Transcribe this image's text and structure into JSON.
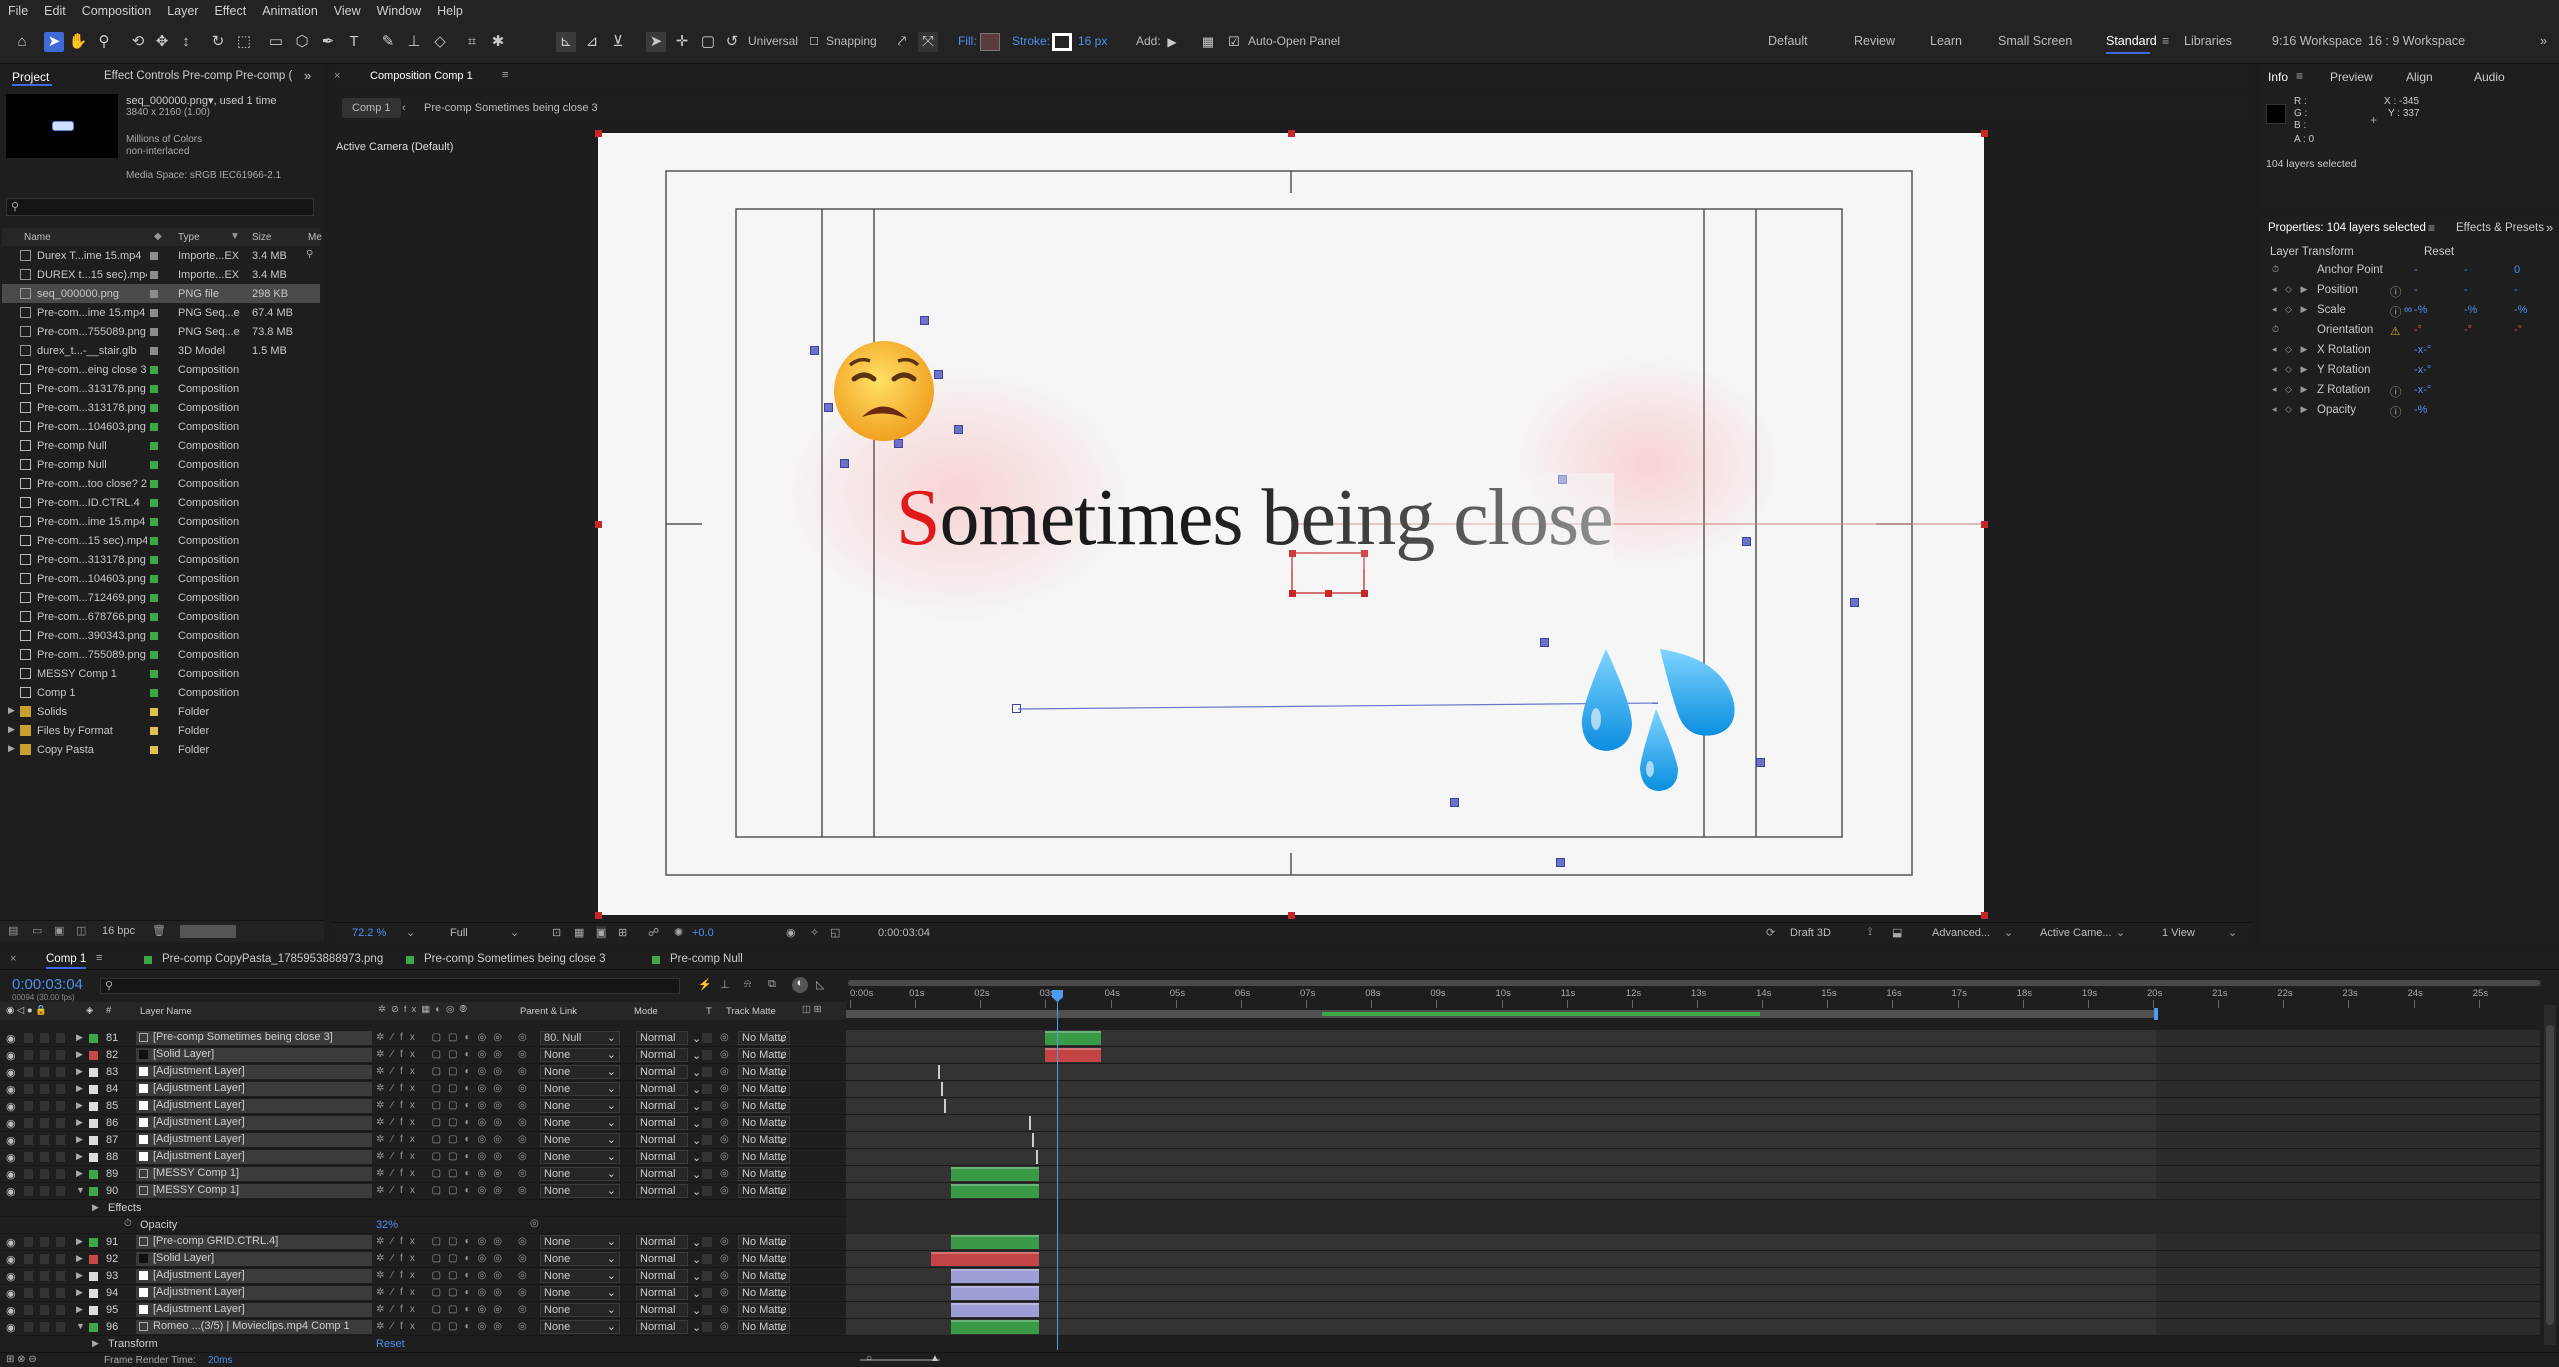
{
  "menu": [
    "File",
    "Edit",
    "Composition",
    "Layer",
    "Effect",
    "Animation",
    "View",
    "Window",
    "Help"
  ],
  "toolbar": {
    "universal": "Universal",
    "snapping": "Snapping",
    "fill": "Fill:",
    "stroke": "Stroke:",
    "stroke_px": "16 px",
    "add": "Add:",
    "auto_open": "Auto-Open Panel"
  },
  "workspaces": [
    "Default",
    "Review",
    "Learn",
    "Small Screen",
    "Standard",
    "Libraries",
    "9:16 Workspace",
    "16 : 9 Workspace"
  ],
  "project": {
    "tab_project": "Project",
    "tab_effects": "Effect Controls Pre-comp Pre-comp (",
    "item_name": "seq_000000.png",
    "item_used": ", used 1 time",
    "item_res": "3840 x 2160 (1.00)",
    "item_colors": "Millions of Colors",
    "item_interlace": "non-interlaced",
    "item_media": "Media Space: sRGB IEC61966-2.1",
    "col_name": "Name",
    "col_type": "Type",
    "col_size": "Size",
    "col_me": "Me",
    "bpc": "16 bpc",
    "rows": [
      {
        "name": "Durex T...ime 15.mp4",
        "type": "Importe...EX",
        "size": "3.4 MB",
        "color": "#8c8c8c"
      },
      {
        "name": "DUREX t...15 sec).mp4",
        "type": "Importe...EX",
        "size": "3.4 MB",
        "color": "#8c8c8c"
      },
      {
        "name": "seq_000000.png",
        "type": "PNG file",
        "size": "298 KB",
        "color": "#8c8c8c"
      },
      {
        "name": "Pre-com...ime 15.mp4",
        "type": "PNG Seq...e",
        "size": "67.4 MB",
        "color": "#8c8c8c"
      },
      {
        "name": "Pre-com...755089.png",
        "type": "PNG Seq...e",
        "size": "73.8 MB",
        "color": "#8c8c8c"
      },
      {
        "name": "durex_t...-__stair.glb",
        "type": "3D Model",
        "size": "1.5 MB",
        "color": "#8c8c8c"
      },
      {
        "name": "Pre-com...eing close 3",
        "type": "Composition",
        "size": "",
        "color": "#3da848"
      },
      {
        "name": "Pre-com...313178.png",
        "type": "Composition",
        "size": "",
        "color": "#3da848"
      },
      {
        "name": "Pre-com...313178.png",
        "type": "Composition",
        "size": "",
        "color": "#3da848"
      },
      {
        "name": "Pre-com...104603.png",
        "type": "Composition",
        "size": "",
        "color": "#3da848"
      },
      {
        "name": "Pre-comp Null",
        "type": "Composition",
        "size": "",
        "color": "#3da848"
      },
      {
        "name": "Pre-comp Null",
        "type": "Composition",
        "size": "",
        "color": "#3da848"
      },
      {
        "name": "Pre-com...too close? 2",
        "type": "Composition",
        "size": "",
        "color": "#3da848"
      },
      {
        "name": "Pre-com...ID.CTRL.4",
        "type": "Composition",
        "size": "",
        "color": "#3da848"
      },
      {
        "name": "Pre-com...ime 15.mp4",
        "type": "Composition",
        "size": "",
        "color": "#3da848"
      },
      {
        "name": "Pre-com...15 sec).mp4",
        "type": "Composition",
        "size": "",
        "color": "#3da848"
      },
      {
        "name": "Pre-com...313178.png",
        "type": "Composition",
        "size": "",
        "color": "#3da848"
      },
      {
        "name": "Pre-com...104603.png",
        "type": "Composition",
        "size": "",
        "color": "#3da848"
      },
      {
        "name": "Pre-com...712469.png",
        "type": "Composition",
        "size": "",
        "color": "#3da848"
      },
      {
        "name": "Pre-com...678766.png",
        "type": "Composition",
        "size": "",
        "color": "#3da848"
      },
      {
        "name": "Pre-com...390343.png",
        "type": "Composition",
        "size": "",
        "color": "#3da848"
      },
      {
        "name": "Pre-com...755089.png",
        "type": "Composition",
        "size": "",
        "color": "#3da848"
      },
      {
        "name": "MESSY Comp 1",
        "type": "Composition",
        "size": "",
        "color": "#3da848"
      },
      {
        "name": "Comp 1",
        "type": "Composition",
        "size": "",
        "color": "#3da848"
      },
      {
        "name": "Solids",
        "type": "Folder",
        "size": "",
        "color": "#e0c050"
      },
      {
        "name": "Files by Format",
        "type": "Folder",
        "size": "",
        "color": "#e0c050"
      },
      {
        "name": "Copy Pasta",
        "type": "Folder",
        "size": "",
        "color": "#e0c050"
      }
    ]
  },
  "composition": {
    "panel_tab": "Composition Comp 1",
    "crumb1": "Comp 1",
    "crumb2": "Pre-comp Sometimes being close 3",
    "camera": "Active Camera (Default)",
    "title_first": "S",
    "title_rest": "ometimes being close"
  },
  "viewer_footer": {
    "zoom": "72.2 %",
    "quality": "Full",
    "exposure": "+0.0",
    "time": "0:00:03:04",
    "draft": "Draft 3D",
    "renderer": "Advanced...",
    "camera": "Active Came...",
    "views": "1 View"
  },
  "info": {
    "tab_info": "Info",
    "tab_preview": "Preview",
    "tab_align": "Align",
    "tab_audio": "Audio",
    "r": "R :",
    "g": "G :",
    "b": "B :",
    "a": "A : 0",
    "x": "X : -345",
    "y": "Y : 337",
    "selected": "104 layers selected"
  },
  "properties": {
    "tab": "Properties: 104 layers selected",
    "tab2": "Effects & Presets",
    "group": "Layer Transform",
    "reset": "Reset",
    "rows": [
      {
        "name": "Anchor Point",
        "v1": "-",
        "v2": "-",
        "v3": "0"
      },
      {
        "name": "Position",
        "v1": "-",
        "v2": "-",
        "v3": "-"
      },
      {
        "name": "Scale",
        "v1": "-%",
        "v2": "-%",
        "v3": "-%"
      },
      {
        "name": "Orientation",
        "v1": "-°",
        "v2": "-°",
        "v3": "-°"
      },
      {
        "name": "X Rotation",
        "v1": "-x-°",
        "v2": "",
        "v3": ""
      },
      {
        "name": "Y Rotation",
        "v1": "-x-°",
        "v2": "",
        "v3": ""
      },
      {
        "name": "Z Rotation",
        "v1": "-x-°",
        "v2": "",
        "v3": ""
      },
      {
        "name": "Opacity",
        "v1": "-%",
        "v2": "",
        "v3": ""
      }
    ]
  },
  "timeline": {
    "tabs": [
      "Comp 1",
      "Pre-comp CopyPasta_1785953888973.png",
      "Pre-comp Sometimes being close 3",
      "Pre-comp Null"
    ],
    "timecode": "0:00:03:04",
    "frames": "00094 (30.00 fps)",
    "col_layer": "Layer Name",
    "col_parent": "Parent & Link",
    "col_mode": "Mode",
    "col_t": "T",
    "col_matte": "Track Matte",
    "ticks": [
      "0:00s",
      "01s",
      "02s",
      "03s",
      "04s",
      "05s",
      "06s",
      "07s",
      "08s",
      "09s",
      "10s",
      "11s",
      "12s",
      "13s",
      "14s",
      "15s",
      "16s",
      "17s",
      "18s",
      "19s",
      "20s",
      "21s",
      "22s",
      "23s",
      "24s",
      "25s"
    ],
    "effects": "Effects",
    "opacity_label": "Opacity",
    "opacity_value": "32%",
    "transform": "Transform",
    "reset": "Reset",
    "render_time_label": "Frame Render Time:",
    "render_time": "20ms",
    "layers": [
      {
        "num": "81",
        "name": "[Pre-comp Sometimes being close 3]",
        "color": "#3da848",
        "parent": "80. Null",
        "mode": "Normal",
        "matte": "No Matte",
        "bar": "green",
        "bstart": 3.0,
        "bend": 3.85
      },
      {
        "num": "82",
        "name": "[Solid Layer]",
        "color": "#c84848",
        "parent": "None",
        "mode": "Normal",
        "matte": "No Matte",
        "bar": "red",
        "bstart": 3.0,
        "bend": 3.85
      },
      {
        "num": "83",
        "name": "[Adjustment Layer]",
        "color": "#dddddd",
        "parent": "None",
        "mode": "Normal",
        "matte": "No Matte",
        "bar": "line",
        "bstart": 1.35,
        "bend": 1.35
      },
      {
        "num": "84",
        "name": "[Adjustment Layer]",
        "color": "#dddddd",
        "parent": "None",
        "mode": "Normal",
        "matte": "No Matte",
        "bar": "line",
        "bstart": 1.4,
        "bend": 1.4
      },
      {
        "num": "85",
        "name": "[Adjustment Layer]",
        "color": "#dddddd",
        "parent": "None",
        "mode": "Normal",
        "matte": "No Matte",
        "bar": "line",
        "bstart": 1.45,
        "bend": 1.45
      },
      {
        "num": "86",
        "name": "[Adjustment Layer]",
        "color": "#dddddd",
        "parent": "None",
        "mode": "Normal",
        "matte": "No Matte",
        "bar": "line",
        "bstart": 2.75,
        "bend": 2.75
      },
      {
        "num": "87",
        "name": "[Adjustment Layer]",
        "color": "#dddddd",
        "parent": "None",
        "mode": "Normal",
        "matte": "No Matte",
        "bar": "line",
        "bstart": 2.8,
        "bend": 2.8
      },
      {
        "num": "88",
        "name": "[Adjustment Layer]",
        "color": "#dddddd",
        "parent": "None",
        "mode": "Normal",
        "matte": "No Matte",
        "bar": "line",
        "bstart": 2.85,
        "bend": 2.85
      },
      {
        "num": "89",
        "name": "[MESSY Comp 1]",
        "color": "#3da848",
        "parent": "None",
        "mode": "Normal",
        "matte": "No Matte",
        "bar": "green",
        "bstart": 1.55,
        "bend": 2.9
      },
      {
        "num": "90",
        "name": "[MESSY Comp 1]",
        "color": "#3da848",
        "parent": "None",
        "mode": "Normal",
        "matte": "No Matte",
        "bar": "green",
        "bstart": 1.55,
        "bend": 2.9
      }
    ],
    "layers2": [
      {
        "num": "91",
        "name": "[Pre-comp GRID.CTRL.4]",
        "color": "#3da848",
        "parent": "None",
        "mode": "Normal",
        "matte": "No Matte",
        "bar": "green",
        "bstart": 1.55,
        "bend": 2.9
      },
      {
        "num": "92",
        "name": "[Solid Layer]",
        "color": "#c84848",
        "parent": "None",
        "mode": "Normal",
        "matte": "No Matte",
        "bar": "red",
        "bstart": 1.25,
        "bend": 2.9
      },
      {
        "num": "93",
        "name": "[Adjustment Layer]",
        "color": "#dddddd",
        "parent": "None",
        "mode": "Normal",
        "matte": "No Matte",
        "bar": "violet",
        "bstart": 1.55,
        "bend": 2.9
      },
      {
        "num": "94",
        "name": "[Adjustment Layer]",
        "color": "#dddddd",
        "parent": "None",
        "mode": "Normal",
        "matte": "No Matte",
        "bar": "violet",
        "bstart": 1.55,
        "bend": 2.9
      },
      {
        "num": "95",
        "name": "[Adjustment Layer]",
        "color": "#dddddd",
        "parent": "None",
        "mode": "Normal",
        "matte": "No Matte",
        "bar": "violet",
        "bstart": 1.55,
        "bend": 2.9
      },
      {
        "num": "96",
        "name": "Romeo ...(3/5) | Movieclips.mp4 Comp 1",
        "color": "#3da848",
        "parent": "None",
        "mode": "Normal",
        "matte": "No Matte",
        "bar": "green",
        "bstart": 1.55,
        "bend": 2.9
      }
    ]
  },
  "colors": {
    "accent": "#3f6ad8",
    "blue_text": "#4d8ff0",
    "playhead": "#4d9cf0"
  }
}
